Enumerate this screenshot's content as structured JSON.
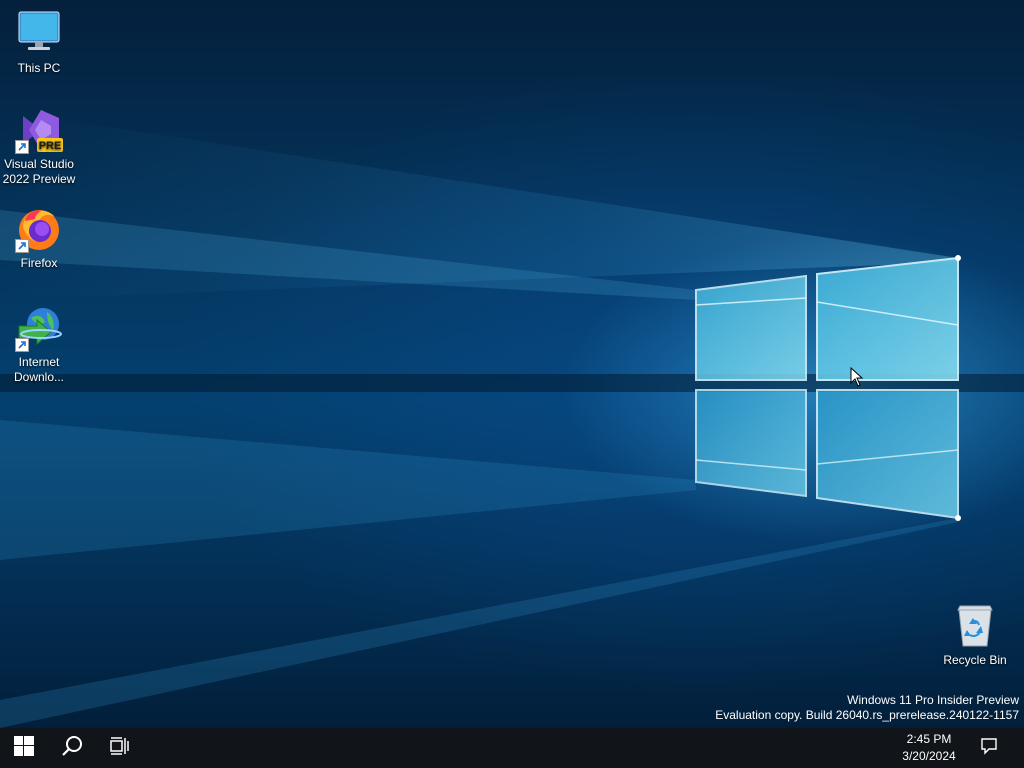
{
  "desktop": {
    "icons": [
      {
        "label": "This PC",
        "icon": "monitor-icon"
      },
      {
        "label": "Visual Studio\n2022 Preview",
        "icon": "visual-studio-preview-icon",
        "badge": "PRE"
      },
      {
        "label": "Firefox",
        "icon": "firefox-icon"
      },
      {
        "label": "Internet\nDownlo...",
        "icon": "internet-download-manager-icon"
      },
      {
        "label": "Recycle Bin",
        "icon": "recycle-bin-icon"
      }
    ]
  },
  "watermark": {
    "line1": "Windows 11 Pro Insider Preview",
    "line2": "Evaluation copy. Build 26040.rs_prerelease.240122-1157"
  },
  "taskbar": {
    "start": "windows-logo-icon",
    "search": "search-icon",
    "task_view": "task-view-icon",
    "time": "2:45 PM",
    "date": "3/20/2024",
    "notifications": "action-center-icon"
  },
  "colors": {
    "taskbar_bg": "#111418",
    "wallpaper_accent": "#5ad4f5",
    "pre_badge": "#f5c518"
  }
}
